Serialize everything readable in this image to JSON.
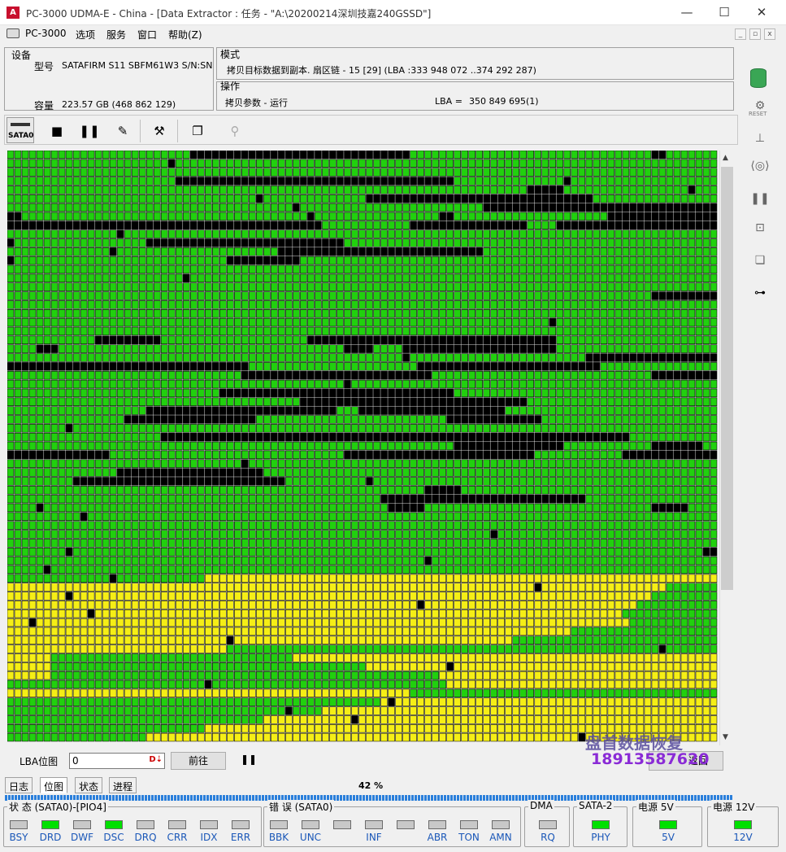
{
  "window": {
    "title": "PC-3000 UDMA-E - China - [Data Extractor : 任务 - \"A:\\20200214深圳技嘉240GSSD\"]",
    "minimize": "—",
    "maximize": "☐",
    "close": "✕"
  },
  "menu": {
    "items": [
      "PC-3000",
      "选项",
      "服务",
      "窗口",
      "帮助(Z)"
    ],
    "mdi_buttons": [
      "_",
      "▫",
      "x"
    ]
  },
  "device": {
    "header": "设备",
    "model_label": "型号",
    "model_value": "SATAFIRM   S11 SBFM61W3 S/N:SN",
    "capacity_label": "容量",
    "capacity_value": "223.57 GB (468 862 129)"
  },
  "mode": {
    "header": "模式",
    "text": "拷贝目标数据到副本. 扇区链 - 15 [29] (LBA :333 948 072 ..374 292 287)"
  },
  "operation": {
    "header": "操作",
    "text": "拷贝参数 - 运行",
    "lba_label": "LBA =",
    "lba_value": "350 849 695(1)"
  },
  "toolbar": {
    "sata_label": "SATA0",
    "icons": [
      "sata-port-icon",
      "stop-icon",
      "pause-icon",
      "edit-icon",
      "tools-icon",
      "copy-windows-icon",
      "walk-icon"
    ]
  },
  "right_tools": {
    "reset_label": "RESET"
  },
  "map": {
    "cols": 97,
    "rows": 67,
    "colors": {
      "green": "#21d00e",
      "black": "#000000",
      "yellow": "#f5ee16",
      "cell_border": "#0a0a0a"
    }
  },
  "nav": {
    "lba_pos_label": "LBA位图",
    "lba_pos_value": "0",
    "go_button": "前往",
    "pause_icon": "pause-icon",
    "back_button": "返回"
  },
  "watermark": {
    "brand": "盘首数据恢复",
    "phone": "18913587620"
  },
  "tabs": [
    "日志",
    "位图",
    "状态",
    "进程"
  ],
  "progress": {
    "percent_text": "42 %",
    "value": 42
  },
  "status_groups": {
    "state": {
      "title": "状 态 (SATA0)-[PIO4]",
      "leds": [
        {
          "label": "BSY",
          "on": false
        },
        {
          "label": "DRD",
          "on": true
        },
        {
          "label": "DWF",
          "on": false
        },
        {
          "label": "DSC",
          "on": true
        },
        {
          "label": "DRQ",
          "on": false
        },
        {
          "label": "CRR",
          "on": false
        },
        {
          "label": "IDX",
          "on": false
        },
        {
          "label": "ERR",
          "on": false
        }
      ]
    },
    "error": {
      "title": "错 误 (SATA0)",
      "leds": [
        {
          "label": "BBK",
          "on": false
        },
        {
          "label": "UNC",
          "on": false
        },
        {
          "label": "",
          "on": false
        },
        {
          "label": "INF",
          "on": false
        },
        {
          "label": "",
          "on": false
        },
        {
          "label": "ABR",
          "on": false
        },
        {
          "label": "TON",
          "on": false
        },
        {
          "label": "AMN",
          "on": false
        }
      ]
    },
    "dma": {
      "title": "DMA",
      "leds": [
        {
          "label": "RQ",
          "on": false
        }
      ]
    },
    "sata2": {
      "title": "SATA-2",
      "leds": [
        {
          "label": "PHY",
          "on": true
        }
      ]
    },
    "power5": {
      "title": "电源 5V",
      "leds": [
        {
          "label": "5V",
          "on": true
        }
      ]
    },
    "power12": {
      "title": "电源 12V",
      "leds": [
        {
          "label": "12V",
          "on": true
        }
      ]
    }
  }
}
